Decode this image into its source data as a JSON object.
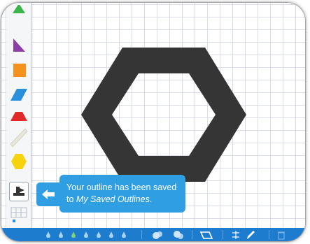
{
  "toast": {
    "line1": "Your outline has been saved",
    "line2_prefix": "to ",
    "line2_destination": "My Saved Outlines",
    "line2_suffix": "."
  },
  "palette": {
    "items": [
      {
        "name": "triangle",
        "color": "#3cb54a"
      },
      {
        "name": "right-triangle",
        "color": "#8b3fa7"
      },
      {
        "name": "square",
        "color": "#f5921e"
      },
      {
        "name": "rhombus",
        "color": "#2a8fdc"
      },
      {
        "name": "trapezoid",
        "color": "#e02a2a"
      },
      {
        "name": "thin-rhombus",
        "color": "#e9e6dc"
      },
      {
        "name": "hexagon",
        "color": "#f7d20f"
      },
      {
        "name": "outline-tool"
      },
      {
        "name": "grid-tool"
      }
    ]
  },
  "canvas": {
    "shape": "hexagon-outline",
    "shape_color": "#353535"
  },
  "bottom_bar": {
    "color": "#1e7ccf",
    "color_drops": 7,
    "tools": [
      "color-mix",
      "overlap",
      "parallelogram-outline",
      "flip",
      "pencil",
      "trash"
    ]
  },
  "accent": "#2f9ee3"
}
